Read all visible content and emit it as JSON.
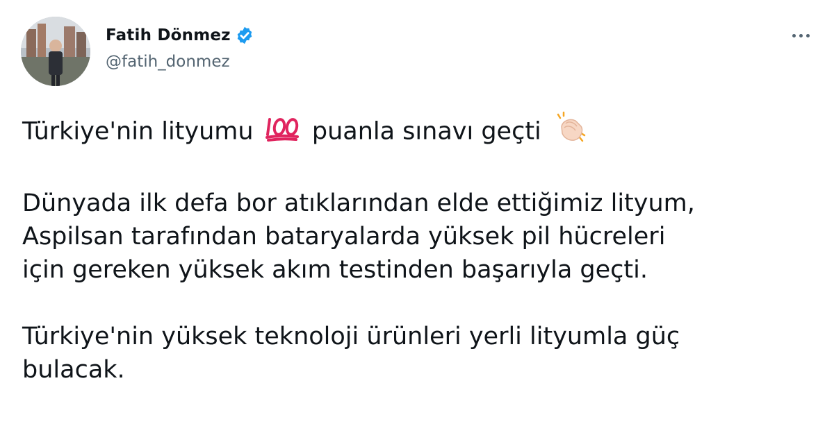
{
  "author": {
    "display_name": "Fatih Dönmez",
    "handle": "@fatih_donmez",
    "verified_icon": "verified-badge-icon",
    "avatar_icon": "avatar-photo"
  },
  "menu": {
    "icon": "more-options-icon"
  },
  "tweet": {
    "para1": {
      "before_emoji": "Türkiye'nin lityumu",
      "emoji1": "hundred-points-emoji",
      "after_emoji": "puanla sınavı geçti",
      "emoji2": "clapping-hands-emoji"
    },
    "para2": {
      "line1": "Dünyada ilk defa bor atıklarından elde ettiğimiz lityum,",
      "line2": "Aspilsan tarafından bataryalarda yüksek pil hücreleri",
      "line3": "için gereken yüksek akım testinden başarıyla geçti."
    },
    "para3": {
      "line1": "Türkiye'nin yüksek teknoloji ürünleri yerli lityumla güç",
      "line2": "bulacak."
    }
  },
  "colors": {
    "verified_blue": "#1d9bf0",
    "secondary_text": "#536471",
    "primary_text": "#0f1419",
    "hundred_red": "#e0245e"
  }
}
